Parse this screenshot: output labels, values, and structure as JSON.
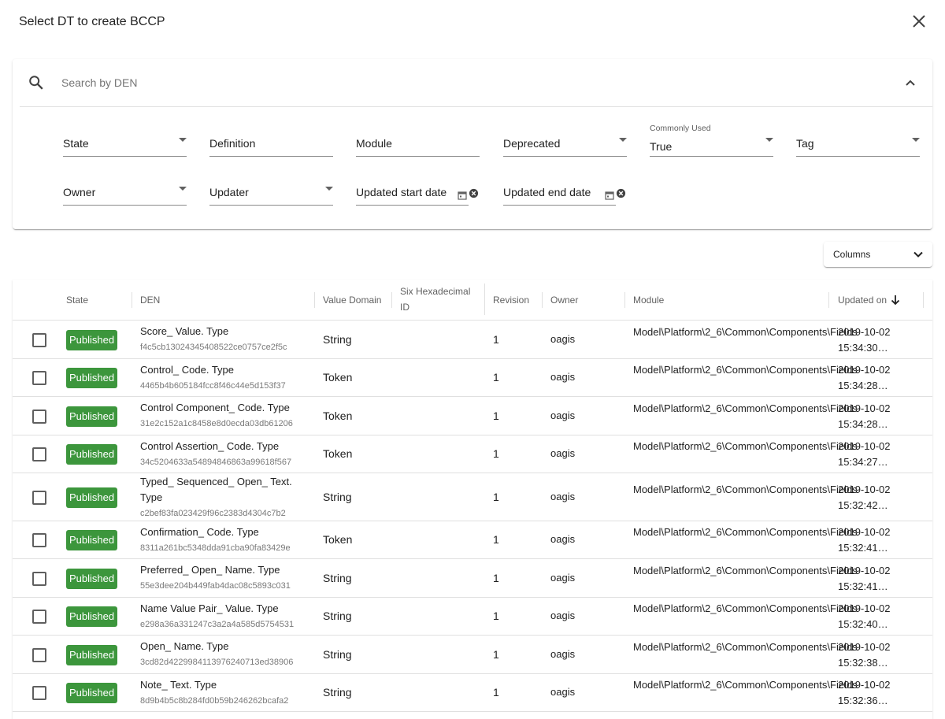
{
  "dialog": {
    "title": "Select DT to create BCCP"
  },
  "search": {
    "placeholder": "Search by DEN"
  },
  "filters": {
    "state": "State",
    "definition": "Definition",
    "module": "Module",
    "deprecated": "Deprecated",
    "commonly_used_label": "Commonly Used",
    "commonly_used_value": "True",
    "tag": "Tag",
    "owner": "Owner",
    "updater": "Updater",
    "updated_start": "Updated start date",
    "updated_end": "Updated end date"
  },
  "columns_button": {
    "label": "Columns"
  },
  "table": {
    "headers": {
      "state": "State",
      "den": "DEN",
      "value_domain": "Value Domain",
      "six_hex": "Six Hexadecimal ID",
      "revision": "Revision",
      "owner": "Owner",
      "module": "Module",
      "updated_on": "Updated on"
    },
    "rows": [
      {
        "state": "Published",
        "den": "Score_ Value. Type",
        "id": "f4c5cb13024345408522ce0757ce2f5c",
        "value_domain": "String",
        "revision": "1",
        "owner": "oagis",
        "module": "Model\\Platform\\2_6\\Common\\Components\\Fields",
        "updated": "2019-10-02 15:34:30…"
      },
      {
        "state": "Published",
        "den": "Control_ Code. Type",
        "id": "4465b4b605184fcc8f46c44e5d153f37",
        "value_domain": "Token",
        "revision": "1",
        "owner": "oagis",
        "module": "Model\\Platform\\2_6\\Common\\Components\\Fields",
        "updated": "2019-10-02 15:34:28…"
      },
      {
        "state": "Published",
        "den": "Control Component_ Code. Type",
        "id": "31e2c152a1c8458e8d0ecda03db61206",
        "value_domain": "Token",
        "revision": "1",
        "owner": "oagis",
        "module": "Model\\Platform\\2_6\\Common\\Components\\Fields",
        "updated": "2019-10-02 15:34:28…"
      },
      {
        "state": "Published",
        "den": "Control Assertion_ Code. Type",
        "id": "34c5204633a54894846863a99618f567",
        "value_domain": "Token",
        "revision": "1",
        "owner": "oagis",
        "module": "Model\\Platform\\2_6\\Common\\Components\\Fields",
        "updated": "2019-10-02 15:34:27…"
      },
      {
        "state": "Published",
        "den": "Typed_ Sequenced_ Open_ Text. Type",
        "id": "c2bef83fa023429f96c2383d4304c7b2",
        "value_domain": "String",
        "revision": "1",
        "owner": "oagis",
        "module": "Model\\Platform\\2_6\\Common\\Components\\Fields",
        "updated": "2019-10-02 15:32:42…"
      },
      {
        "state": "Published",
        "den": "Confirmation_ Code. Type",
        "id": "8311a261bc5348dda91cba90fa83429e",
        "value_domain": "Token",
        "revision": "1",
        "owner": "oagis",
        "module": "Model\\Platform\\2_6\\Common\\Components\\Fields",
        "updated": "2019-10-02 15:32:41…"
      },
      {
        "state": "Published",
        "den": "Preferred_ Open_ Name. Type",
        "id": "55e3dee204b449fab4dac08c5893c031",
        "value_domain": "String",
        "revision": "1",
        "owner": "oagis",
        "module": "Model\\Platform\\2_6\\Common\\Components\\Fields",
        "updated": "2019-10-02 15:32:41…"
      },
      {
        "state": "Published",
        "den": "Name Value Pair_ Value. Type",
        "id": "e298a36a331247c3a2a4a585d5754531",
        "value_domain": "String",
        "revision": "1",
        "owner": "oagis",
        "module": "Model\\Platform\\2_6\\Common\\Components\\Fields",
        "updated": "2019-10-02 15:32:40…"
      },
      {
        "state": "Published",
        "den": "Open_ Name. Type",
        "id": "3cd82d4229984113976240713ed38906",
        "value_domain": "String",
        "revision": "1",
        "owner": "oagis",
        "module": "Model\\Platform\\2_6\\Common\\Components\\Fields",
        "updated": "2019-10-02 15:32:38…"
      },
      {
        "state": "Published",
        "den": "Note_ Text. Type",
        "id": "8d9b4b5c8b284fd0b59b246262bcafa2",
        "value_domain": "String",
        "revision": "1",
        "owner": "oagis",
        "module": "Model\\Platform\\2_6\\Common\\Components\\Fields",
        "updated": "2019-10-02 15:32:36…"
      }
    ]
  },
  "colors": {
    "published_badge": "#3c963c"
  }
}
